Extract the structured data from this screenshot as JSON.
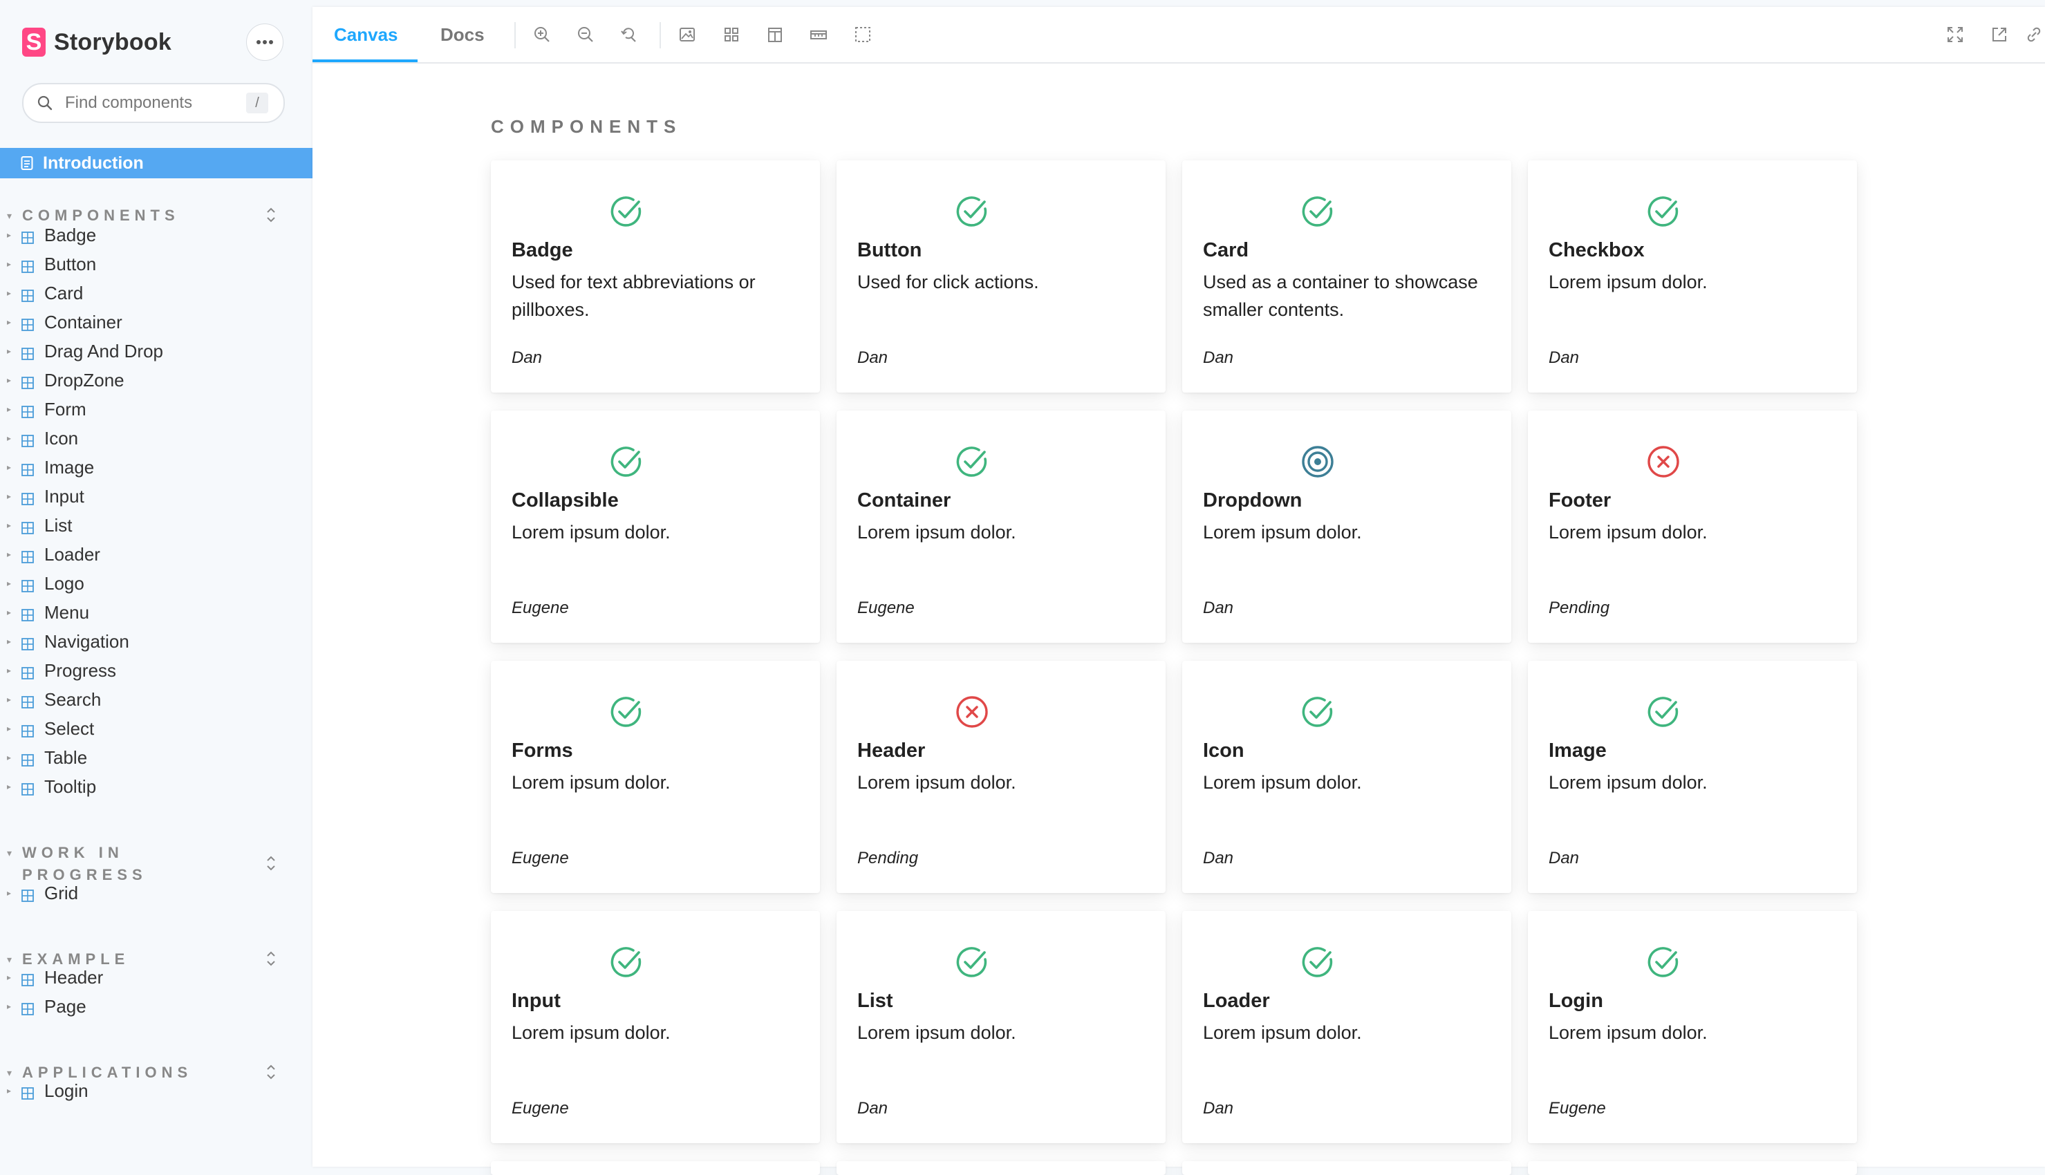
{
  "brand": {
    "name": "Storybook",
    "logo_letter": "S",
    "accent": "#ff4785"
  },
  "sidebar": {
    "menu_icon": "ellipsis-icon",
    "search": {
      "placeholder": "Find components",
      "shortcut": "/"
    },
    "intro": {
      "label": "Introduction"
    },
    "sections": [
      {
        "title": "COMPONENTS",
        "items": [
          "Badge",
          "Button",
          "Card",
          "Container",
          "Drag And Drop",
          "DropZone",
          "Form",
          "Icon",
          "Image",
          "Input",
          "List",
          "Loader",
          "Logo",
          "Menu",
          "Navigation",
          "Progress",
          "Search",
          "Select",
          "Table",
          "Tooltip"
        ]
      },
      {
        "title": "WORK IN PROGRESS",
        "items": [
          "Grid"
        ]
      },
      {
        "title": "EXAMPLE",
        "items": [
          "Header",
          "Page"
        ]
      },
      {
        "title": "APPLICATIONS",
        "items": [
          "Login"
        ]
      }
    ]
  },
  "toolbar": {
    "tabs": [
      "Canvas",
      "Docs"
    ],
    "active_tab": "Canvas",
    "tools": [
      "zoom-in-icon",
      "zoom-out-icon",
      "zoom-reset-icon",
      "background-icon",
      "grid-icon",
      "viewport-icon",
      "measure-icon",
      "outline-icon"
    ],
    "right_tools": [
      "fullscreen-icon",
      "open-new-tab-icon",
      "copy-link-icon"
    ]
  },
  "content": {
    "heading": "COMPONENTS",
    "cards": [
      {
        "title": "Badge",
        "desc": "Used for text abbreviations or pillboxes.",
        "author": "Dan",
        "status": "done"
      },
      {
        "title": "Button",
        "desc": "Used for click actions.",
        "author": "Dan",
        "status": "done"
      },
      {
        "title": "Card",
        "desc": "Used as a container to showcase smaller contents.",
        "author": "Dan",
        "status": "done"
      },
      {
        "title": "Checkbox",
        "desc": "Lorem ipsum dolor.",
        "author": "Dan",
        "status": "done"
      },
      {
        "title": "Collapsible",
        "desc": "Lorem ipsum dolor.",
        "author": "Eugene",
        "status": "done"
      },
      {
        "title": "Container",
        "desc": "Lorem ipsum dolor.",
        "author": "Eugene",
        "status": "done"
      },
      {
        "title": "Dropdown",
        "desc": "Lorem ipsum dolor.",
        "author": "Dan",
        "status": "in-progress"
      },
      {
        "title": "Footer",
        "desc": "Lorem ipsum dolor.",
        "author": "Pending",
        "status": "pending"
      },
      {
        "title": "Forms",
        "desc": "Lorem ipsum dolor.",
        "author": "Eugene",
        "status": "done"
      },
      {
        "title": "Header",
        "desc": "Lorem ipsum dolor.",
        "author": "Pending",
        "status": "pending"
      },
      {
        "title": "Icon",
        "desc": "Lorem ipsum dolor.",
        "author": "Dan",
        "status": "done"
      },
      {
        "title": "Image",
        "desc": "Lorem ipsum dolor.",
        "author": "Dan",
        "status": "done"
      },
      {
        "title": "Input",
        "desc": "Lorem ipsum dolor.",
        "author": "Eugene",
        "status": "done"
      },
      {
        "title": "List",
        "desc": "Lorem ipsum dolor.",
        "author": "Dan",
        "status": "done"
      },
      {
        "title": "Loader",
        "desc": "Lorem ipsum dolor.",
        "author": "Dan",
        "status": "done"
      },
      {
        "title": "Login",
        "desc": "Lorem ipsum dolor.",
        "author": "Eugene",
        "status": "done"
      }
    ]
  },
  "colors": {
    "done": "#3fb57e",
    "in-progress": "#3d7f96",
    "pending": "#e04848",
    "selected": "#55a8f2",
    "tab_active": "#1ea7fd"
  }
}
